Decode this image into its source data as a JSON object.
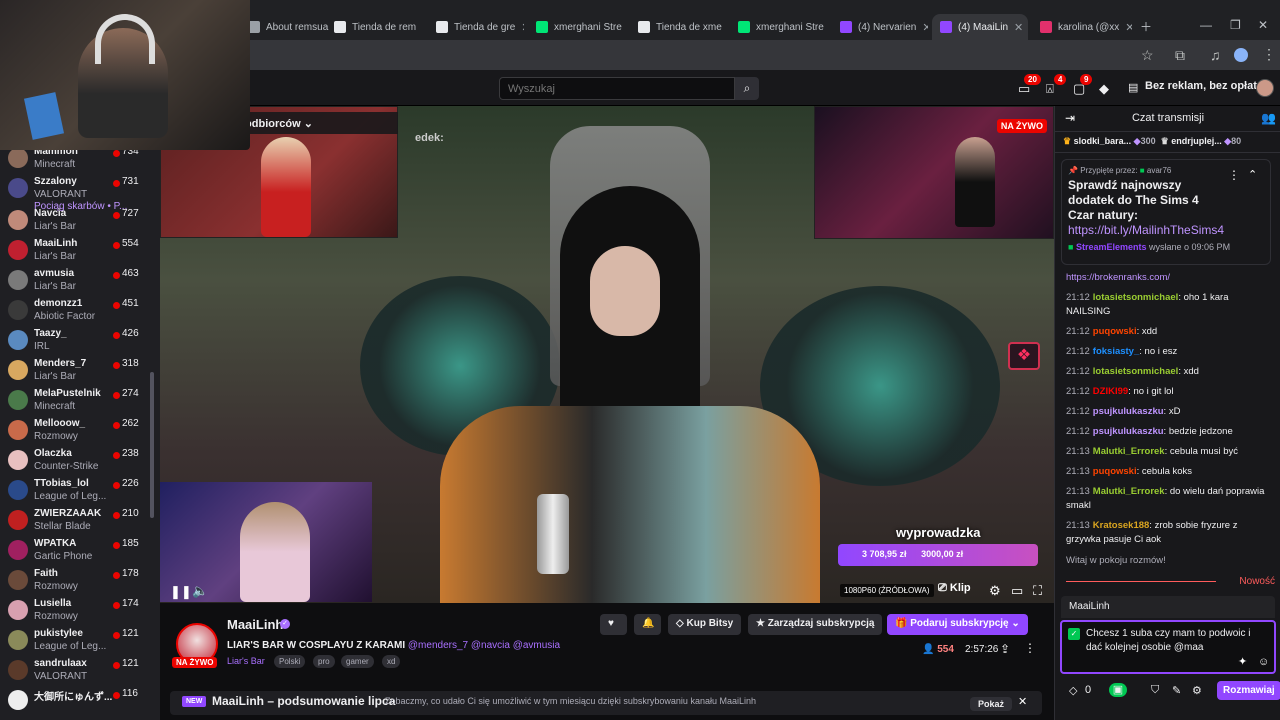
{
  "browser": {
    "tabs": [
      {
        "label": "About remsua",
        "color": "#9aa0a6"
      },
      {
        "label": "Tienda de rem",
        "color": "#e8eaed"
      },
      {
        "label": "Tienda de gre",
        "color": "#e8eaed"
      },
      {
        "label": "xmerghani Stre",
        "color": "#00e676"
      },
      {
        "label": "Tienda de xme",
        "color": "#e8eaed"
      },
      {
        "label": "xmerghani Stre",
        "color": "#00e676"
      },
      {
        "label": "(4) Nervarien",
        "color": "#9147ff"
      },
      {
        "label": "(4) MaaiLin",
        "color": "#9147ff"
      },
      {
        "label": "karolina (@xx",
        "color": "#e1306c"
      }
    ]
  },
  "nav": {
    "search_placeholder": "Wyszukaj",
    "badge_inbox": "20",
    "badge_notif": "4",
    "badge_whisper": "9",
    "no_ads": "Bez reklam, bez opłat"
  },
  "sidebar": {
    "channels": [
      {
        "name": "Mammon",
        "game": "Minecraft",
        "viewers": "734",
        "color": "#8a6a5a"
      },
      {
        "name": "Szzalony",
        "game": "VALORANT",
        "sub": "Pociąg skarbów • P...",
        "viewers": "731",
        "color": "#4a4a8a"
      },
      {
        "name": "Navcia",
        "game": "Liar's Bar",
        "viewers": "727",
        "color": "#c08a7a"
      },
      {
        "name": "MaaiLinh",
        "game": "Liar's Bar",
        "viewers": "554",
        "color": "#c02030"
      },
      {
        "name": "avmusia",
        "game": "Liar's Bar",
        "viewers": "463",
        "color": "#7a7a7a"
      },
      {
        "name": "demonzz1",
        "game": "Abiotic Factor",
        "viewers": "451",
        "color": "#3a3a3a"
      },
      {
        "name": "Taazy_",
        "game": "IRL",
        "viewers": "426",
        "color": "#5a8ac0"
      },
      {
        "name": "Menders_7",
        "game": "Liar's Bar",
        "viewers": "318",
        "color": "#d8a860"
      },
      {
        "name": "MelaPustelnik",
        "game": "Minecraft",
        "viewers": "274",
        "color": "#4a7a4a"
      },
      {
        "name": "Mellooow_",
        "game": "Rozmowy",
        "viewers": "262",
        "color": "#c86a4a"
      },
      {
        "name": "Olaczka",
        "game": "Counter-Strike",
        "viewers": "238",
        "color": "#e8c0c0"
      },
      {
        "name": "TTobias_lol",
        "game": "League of Leg...",
        "viewers": "226",
        "color": "#2a4a8a"
      },
      {
        "name": "ZWIERZAAAK",
        "game": "Stellar Blade",
        "viewers": "210",
        "color": "#c02020"
      },
      {
        "name": "WPATKA",
        "game": "Gartic Phone",
        "viewers": "185",
        "color": "#a02060"
      },
      {
        "name": "Faith",
        "game": "Rozmowy",
        "viewers": "178",
        "color": "#6a4a3a"
      },
      {
        "name": "Lusiella",
        "game": "Rozmowy",
        "viewers": "174",
        "color": "#d8a0b0"
      },
      {
        "name": "pukistylee",
        "game": "League of Leg...",
        "viewers": "121",
        "color": "#8a8a5a"
      },
      {
        "name": "sandrulaax",
        "game": "VALORANT",
        "viewers": "121",
        "color": "#5a3a2a"
      },
      {
        "name": "大御所にゅんず...",
        "game": "",
        "viewers": "116",
        "color": "#eeeeee"
      }
    ]
  },
  "video": {
    "audience_label": "a określonych odbiorców",
    "leader_partial": "edek:",
    "live": "NA ŻYWO",
    "goal_title": "wyprowadzka",
    "goal_current": "3 708,95 zł",
    "goal_target": "3000,00 zł",
    "quality": "1080P60 (ŹRÓDŁOWA)",
    "clip": "Klip"
  },
  "stream": {
    "channel": "MaaiLinh",
    "live": "NA ŻYWO",
    "title": "LIAR'S BAR W COSPLAYU Z KARAMI",
    "mentions": "@menders_7 @navcia @avmusia",
    "game": "Liar's Bar",
    "tags": [
      "Polski",
      "pro",
      "gamer",
      "xd"
    ],
    "viewers": "554",
    "uptime": "2:57:26",
    "bits": "Kup Bitsy",
    "manage_sub": "Zarządzaj subskrypcją",
    "gift_sub": "Podaruj subskrypcję",
    "banner_new": "NEW",
    "banner_title": "MaaiLinh – podsumowanie lipca",
    "banner_text": "Zobaczmy, co udało Ci się umożliwić w tym miesiącu dzięki subskrybowaniu kanału MaaiLinh",
    "banner_show": "Pokaż"
  },
  "chat": {
    "title": "Czat transmisji",
    "hype": [
      {
        "name": "slodki_bara...",
        "amount": "300"
      },
      {
        "name": "endrjuplej...",
        "amount": "80"
      }
    ],
    "pinned_by": "Przypięte przez:",
    "pinned_user": "avar76",
    "pinned_text": "Sprawdź najnowszy dodatek do The Sims 4 Czar natury:",
    "pinned_link": "https://bit.ly/MailinhTheSims4",
    "pinned_author": "StreamElements",
    "pinned_time": "wysłane o 09:06 PM",
    "messages": [
      {
        "time": "",
        "user": "",
        "color": "#bf94ff",
        "text": "https://brokenranks.com/"
      },
      {
        "time": "21:12",
        "user": "lotasietsonmichael",
        "color": "#9acd32",
        "text": "oho 1 kara NAILSING"
      },
      {
        "time": "21:12",
        "user": "puqowski",
        "color": "#ff4500",
        "text": "xdd"
      },
      {
        "time": "21:12",
        "user": "foksiasty_",
        "color": "#1e90ff",
        "text": "no i esz"
      },
      {
        "time": "21:12",
        "user": "lotasietsonmichael",
        "color": "#9acd32",
        "text": "xdd"
      },
      {
        "time": "21:12",
        "user": "DZIKI99",
        "color": "#ff0000",
        "text": "no i git lol"
      },
      {
        "time": "21:12",
        "user": "psujkulukaszku",
        "color": "#bf94ff",
        "text": "xD"
      },
      {
        "time": "21:12",
        "user": "psujkulukaszku",
        "color": "#bf94ff",
        "text": "bedzie jedzone"
      },
      {
        "time": "21:13",
        "user": "Malutki_Errorek",
        "color": "#9acd32",
        "text": "cebula musi być"
      },
      {
        "time": "21:13",
        "user": "puqowski",
        "color": "#ff4500",
        "text": "cebula koks"
      },
      {
        "time": "21:13",
        "user": "Malutki_Errorek",
        "color": "#9acd32",
        "text": "do wielu dań poprawia smakl"
      },
      {
        "time": "21:13",
        "user": "Kratosek188",
        "color": "#daa520",
        "text": "zrob sobie fryzure z grzywka pasuje Ci aok"
      }
    ],
    "welcome": "Witaj w pokoju rozmów!",
    "new_label": "Nowość",
    "reply_to": "MaaiLinh",
    "input_text": "Chcesz 1 suba czy mam to podwoic i dać kolejnej osobie @maa",
    "points": "0",
    "send": "Rozmawiaj"
  }
}
